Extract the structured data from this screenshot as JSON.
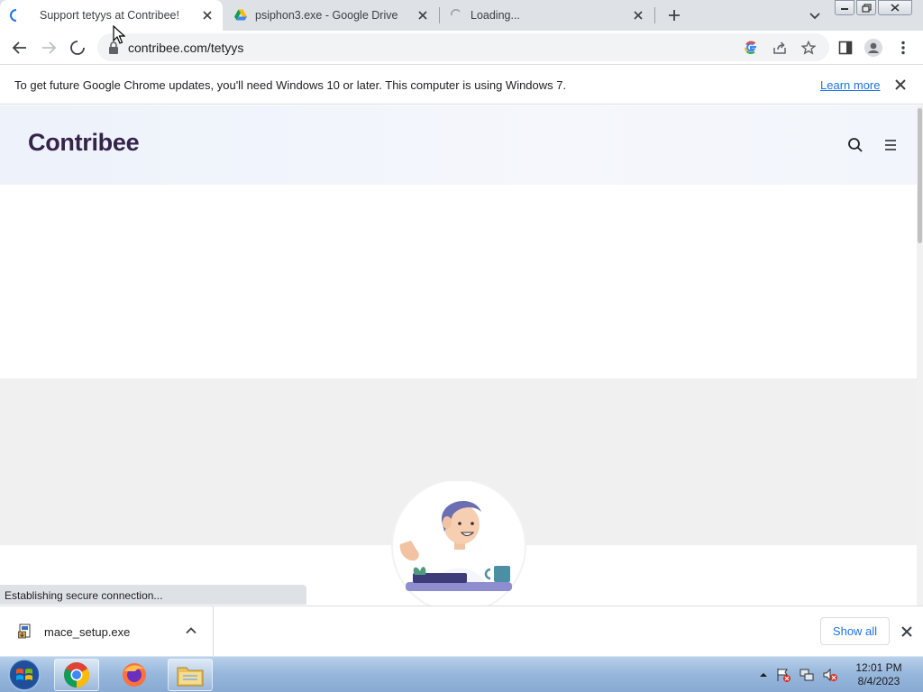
{
  "browser": {
    "tabs": [
      {
        "title": "Support tetyys at Contribee!",
        "state": "active"
      },
      {
        "title": "psiphon3.exe - Google Drive",
        "state": "inactive"
      },
      {
        "title": "Loading...",
        "state": "loading"
      }
    ],
    "address": "contribee.com/tetyys"
  },
  "infobar": {
    "message": "To get future Google Chrome updates, you'll need Windows 10 or later. This computer is using Windows 7.",
    "learn_more": "Learn more"
  },
  "site": {
    "logo": "Contribee",
    "brand_color": "#35234a"
  },
  "status_text": "Establishing secure connection...",
  "downloads": {
    "file_name": "mace_setup.exe",
    "show_all": "Show all"
  },
  "taskbar": {
    "apps": [
      "chrome",
      "firefox",
      "file-explorer"
    ],
    "time": "12:01 PM",
    "date": "8/4/2023"
  }
}
